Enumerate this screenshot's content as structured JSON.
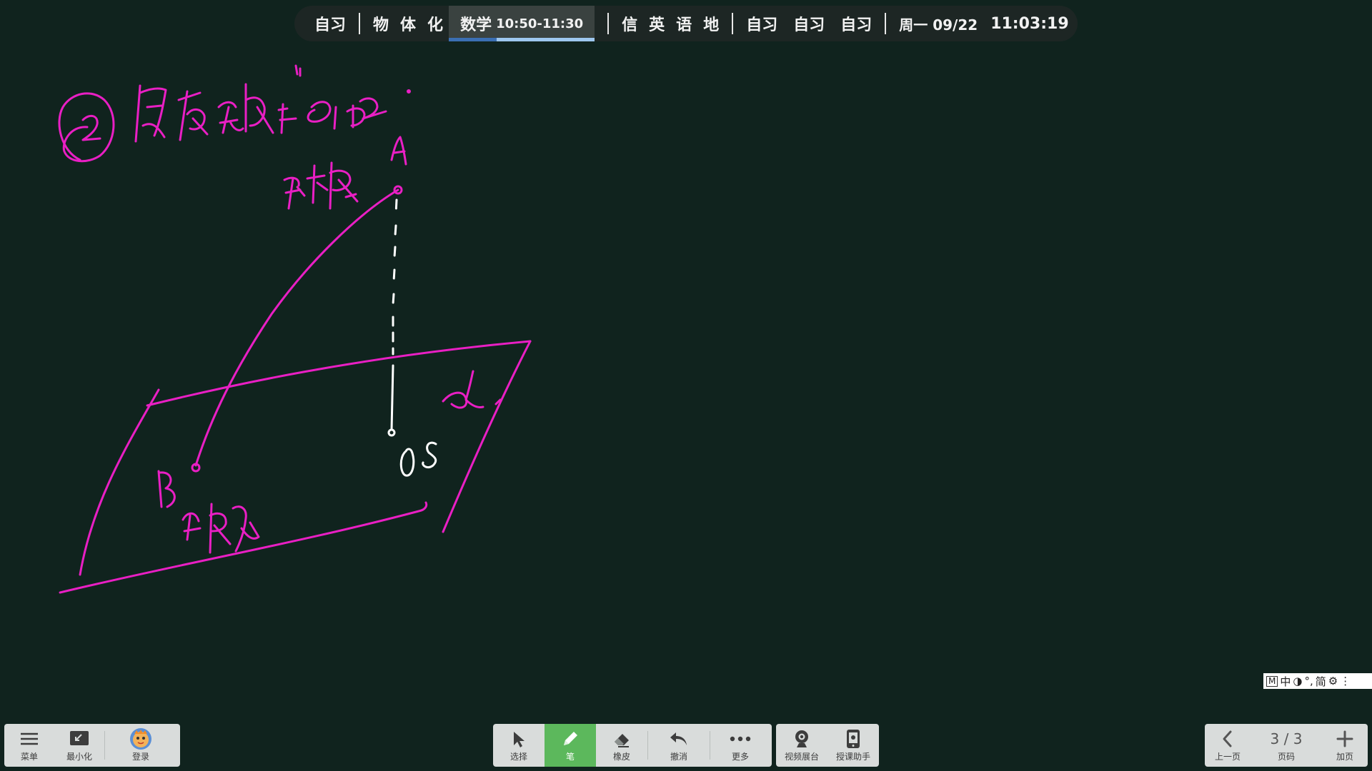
{
  "schedule": {
    "group1": [
      "自习"
    ],
    "group2": [
      "物",
      "体",
      "化"
    ],
    "current": {
      "name": "数学",
      "time": "10:50-11:30",
      "progress": 0.33
    },
    "group3": [
      "信",
      "英",
      "语",
      "地"
    ],
    "group4": [
      "自习",
      "自习",
      "自习"
    ],
    "date": "周一 09/22",
    "clock": "11:03:19"
  },
  "board": {
    "ink_colors": {
      "pink": "#e91fc4",
      "white": "#ffffff"
    },
    "background": "#10231e"
  },
  "ime": {
    "mode": "M",
    "lang": "中",
    "punct": "°,",
    "script": "简",
    "settings_icon": "gear-icon",
    "more": "⋮"
  },
  "left_toolbar": {
    "menu": {
      "label": "菜单",
      "icon": "menu-icon"
    },
    "minimize": {
      "label": "最小化",
      "icon": "minimize-icon"
    },
    "login": {
      "label": "登录",
      "icon": "avatar-icon"
    }
  },
  "center_toolbar": {
    "select": {
      "label": "选择",
      "icon": "cursor-icon"
    },
    "pen": {
      "label": "笔",
      "icon": "pen-icon",
      "active": true
    },
    "eraser": {
      "label": "橡皮",
      "icon": "eraser-icon"
    },
    "undo": {
      "label": "撤消",
      "icon": "undo-icon"
    },
    "more": {
      "label": "更多",
      "icon": "more-icon"
    }
  },
  "tools_toolbar": {
    "camera": {
      "label": "视频展台",
      "icon": "webcam-icon"
    },
    "assistant": {
      "label": "授课助手",
      "icon": "tablet-icon"
    }
  },
  "pager": {
    "prev": {
      "label": "上一页",
      "icon": "chevron-left-icon"
    },
    "page": {
      "current": "3",
      "total": "3",
      "display": "3 / 3",
      "label": "页码"
    },
    "add": {
      "label": "加页",
      "icon": "plus-icon"
    }
  }
}
